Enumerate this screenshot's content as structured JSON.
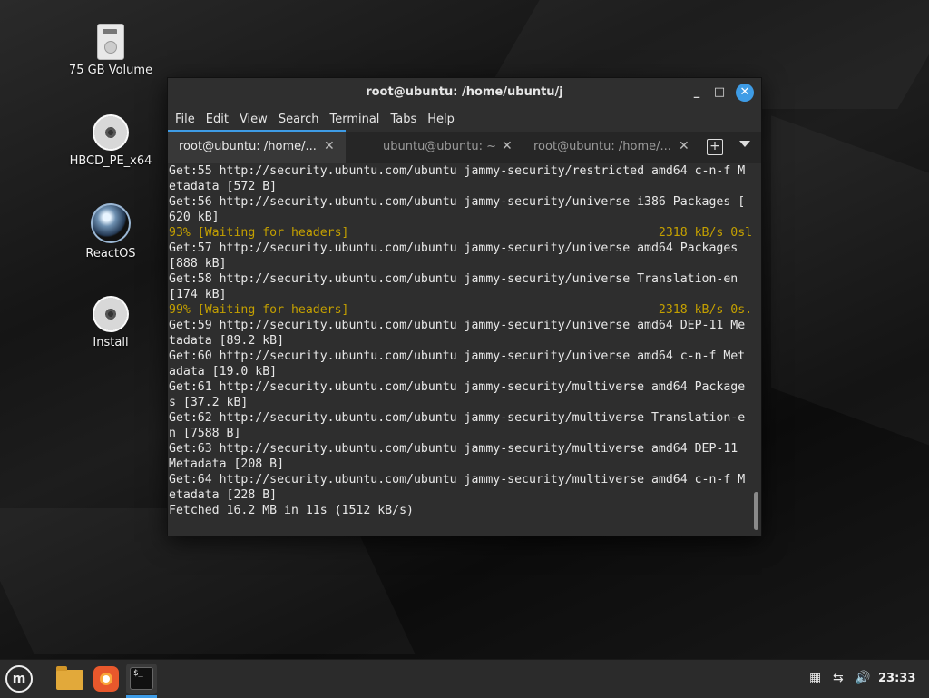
{
  "desktop": {
    "icons": [
      {
        "label": "75 GB Volume",
        "icon": "drive-icon"
      },
      {
        "label": "HBCD_PE_x64",
        "icon": "disc-icon"
      },
      {
        "label": "ReactOS",
        "icon": "reactos-icon"
      },
      {
        "label": "Install",
        "icon": "disc-icon"
      }
    ]
  },
  "window": {
    "title": "root@ubuntu: /home/ubuntu/j",
    "controls": {
      "minimize": "_",
      "maximize": "□",
      "close": "✕"
    },
    "menu": [
      "File",
      "Edit",
      "View",
      "Search",
      "Terminal",
      "Tabs",
      "Help"
    ],
    "tabs": [
      {
        "label": "root@ubuntu: /home/...",
        "active": true
      },
      {
        "label": "ubuntu@ubuntu: ~",
        "active": false
      },
      {
        "label": "root@ubuntu: /home/...",
        "active": false
      }
    ],
    "tab_close": "✕",
    "add_tab": "+",
    "terminal_lines": [
      {
        "text": "Get:55 http://security.ubuntu.com/ubuntu jammy-security/restricted amd64 c-n-f M",
        "style": "normal"
      },
      {
        "text": "etadata [572 B]",
        "style": "normal"
      },
      {
        "text": "Get:56 http://security.ubuntu.com/ubuntu jammy-security/universe i386 Packages [",
        "style": "normal"
      },
      {
        "text": "620 kB]",
        "style": "normal"
      },
      {
        "text": "93% [Waiting for headers]                                           2318 kB/s 0sl",
        "style": "warn"
      },
      {
        "text": "Get:57 http://security.ubuntu.com/ubuntu jammy-security/universe amd64 Packages",
        "style": "normal"
      },
      {
        "text": "[888 kB]",
        "style": "normal"
      },
      {
        "text": "Get:58 http://security.ubuntu.com/ubuntu jammy-security/universe Translation-en",
        "style": "normal"
      },
      {
        "text": "[174 kB]",
        "style": "normal"
      },
      {
        "text": "99% [Waiting for headers]                                           2318 kB/s 0s.",
        "style": "warn"
      },
      {
        "text": "Get:59 http://security.ubuntu.com/ubuntu jammy-security/universe amd64 DEP-11 Me",
        "style": "normal"
      },
      {
        "text": "tadata [89.2 kB]",
        "style": "normal"
      },
      {
        "text": "Get:60 http://security.ubuntu.com/ubuntu jammy-security/universe amd64 c-n-f Met",
        "style": "normal"
      },
      {
        "text": "adata [19.0 kB]",
        "style": "normal"
      },
      {
        "text": "Get:61 http://security.ubuntu.com/ubuntu jammy-security/multiverse amd64 Package",
        "style": "normal"
      },
      {
        "text": "s [37.2 kB]",
        "style": "normal"
      },
      {
        "text": "Get:62 http://security.ubuntu.com/ubuntu jammy-security/multiverse Translation-e",
        "style": "normal"
      },
      {
        "text": "n [7588 B]",
        "style": "normal"
      },
      {
        "text": "Get:63 http://security.ubuntu.com/ubuntu jammy-security/multiverse amd64 DEP-11",
        "style": "normal"
      },
      {
        "text": "Metadata [208 B]",
        "style": "normal"
      },
      {
        "text": "Get:64 http://security.ubuntu.com/ubuntu jammy-security/multiverse amd64 c-n-f M",
        "style": "normal"
      },
      {
        "text": "etadata [228 B]",
        "style": "normal"
      },
      {
        "text": "Fetched 16.2 MB in 11s (1512 kB/s)",
        "style": "normal"
      }
    ]
  },
  "taskbar": {
    "menu_button": "m",
    "apps": [
      {
        "name": "files",
        "icon": "folder-icon"
      },
      {
        "name": "firefox",
        "icon": "firefox-icon"
      },
      {
        "name": "terminal",
        "icon": "terminal-icon",
        "glyph": "$_",
        "active": true
      }
    ],
    "tray": {
      "clock": "23:33"
    }
  },
  "colors": {
    "accent": "#3e9ce6",
    "terminal_bg": "#2e2e2e",
    "terminal_fg": "#e8e8e8",
    "warn_fg": "#c4a000"
  }
}
